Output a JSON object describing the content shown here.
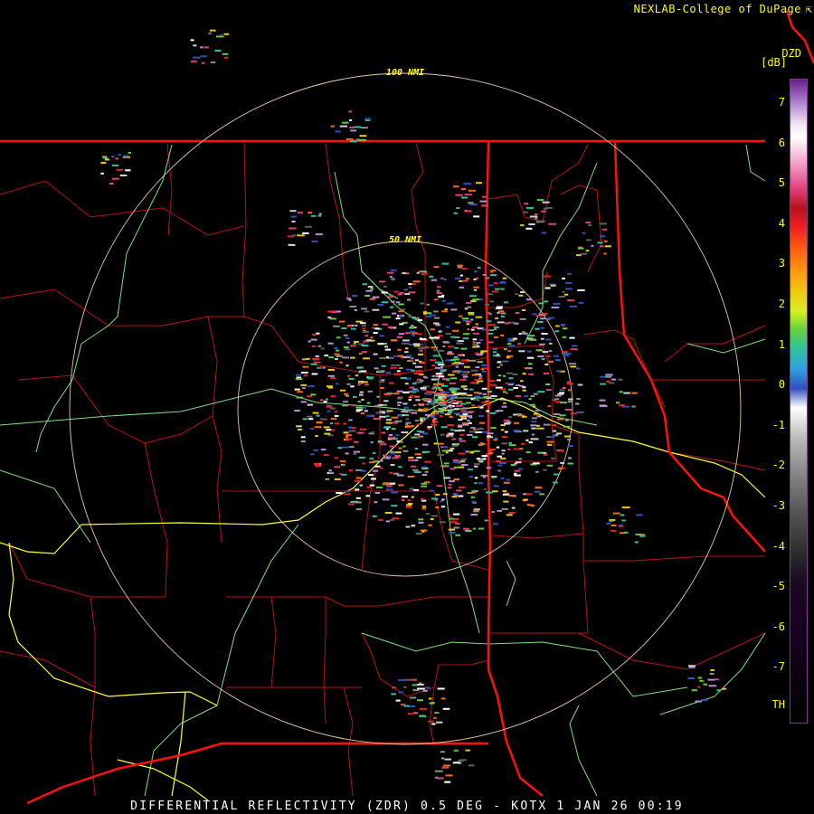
{
  "header": {
    "credit": "NEXLAB-College of DuPage",
    "credit_icon": "external-link-icon",
    "product_code": "DZD",
    "unit": "[dB]"
  },
  "footer": {
    "caption": "DIFFERENTIAL REFLECTIVITY (ZDR) 0.5 DEG - KOTX 1 JAN 26 00:19"
  },
  "range_rings": [
    {
      "label": "50 NMI",
      "nmi": 50
    },
    {
      "label": "100 NMI",
      "nmi": 100
    }
  ],
  "colorbar": {
    "ticks": [
      "7",
      "6",
      "5",
      "4",
      "3",
      "2",
      "1",
      "0",
      "-1",
      "-2",
      "-3",
      "-4",
      "-5",
      "-6",
      "-7",
      "TH"
    ]
  },
  "colors": {
    "state_border": "#ff1010",
    "county_border": "#c81414",
    "highway": "#ffff30",
    "river": "#7fe07f",
    "range_ring": "#e8c6a0",
    "label": "#ffff00"
  }
}
